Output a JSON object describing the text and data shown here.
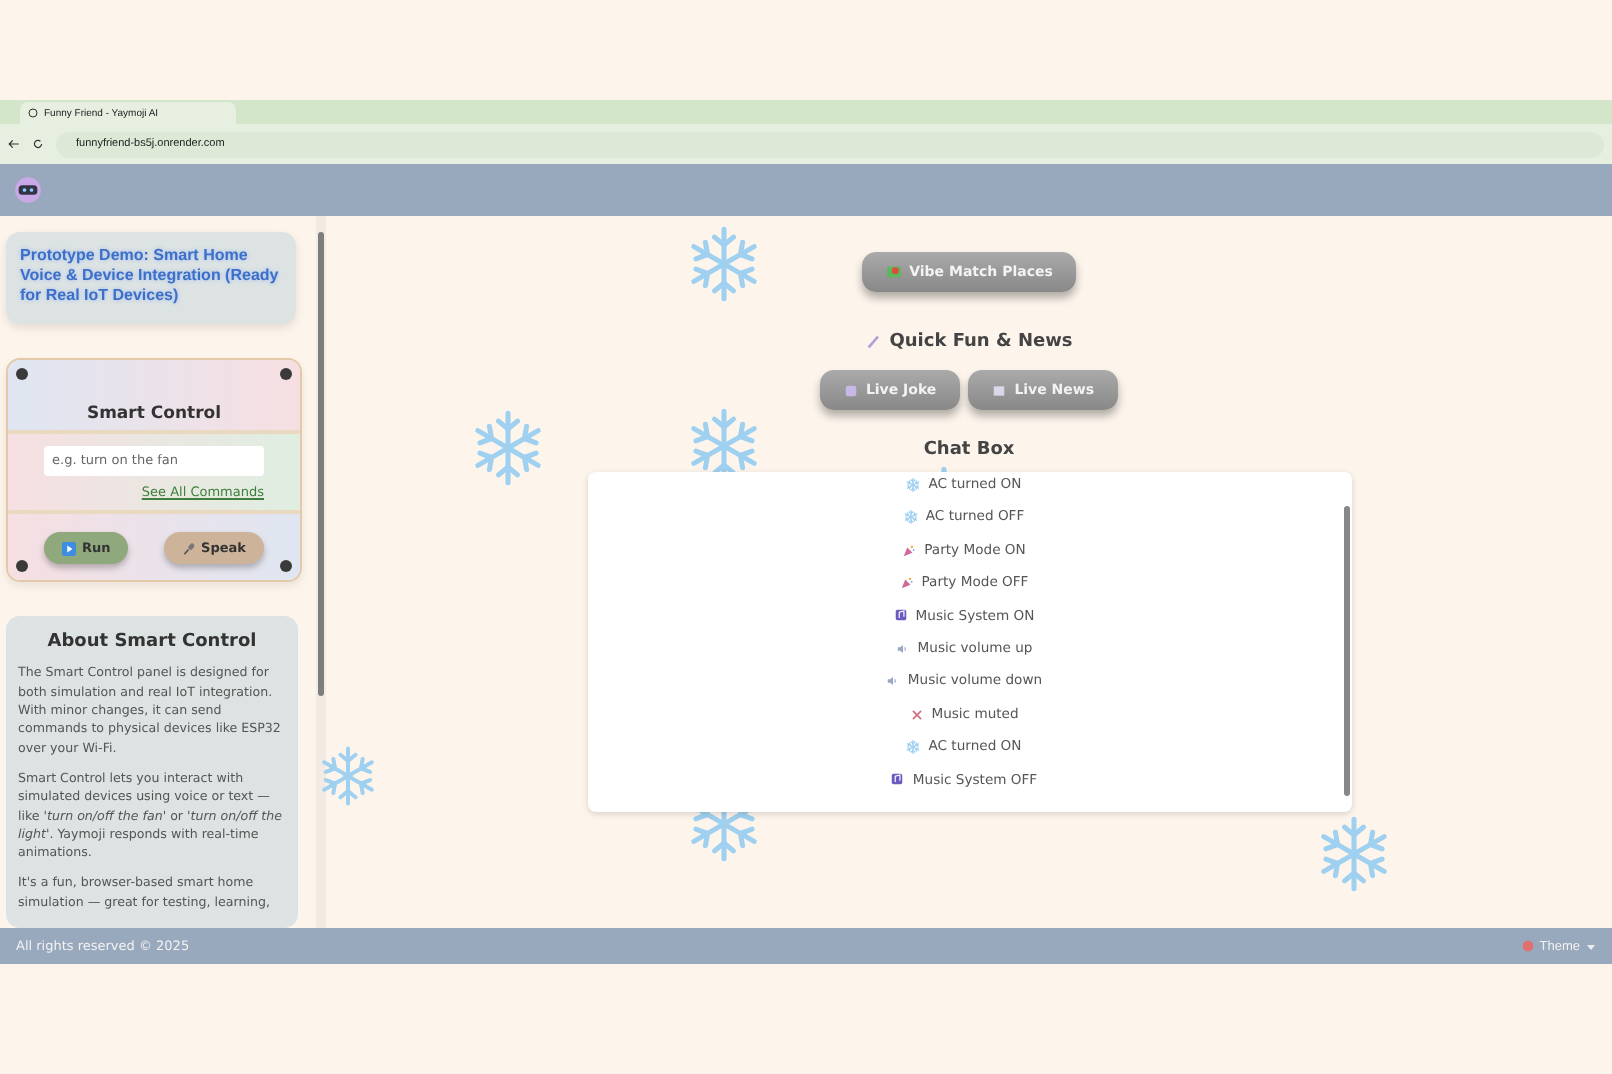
{
  "browser": {
    "tab_title": "Funny Friend - Yaymoji AI",
    "url": "funnyfriend-bs5j.onrender.com"
  },
  "sidebar": {
    "demo_title": "Prototype Demo: Smart Home Voice & Device Integration (Ready for Real IoT Devices)",
    "smart_control": {
      "title": "Smart Control",
      "input_placeholder": "e.g. turn on the fan",
      "commands_link": "See All Commands",
      "buttons": [
        {
          "label": "Run",
          "kind": "run"
        },
        {
          "label": "Speak",
          "kind": "speak"
        }
      ]
    },
    "about": {
      "title": "About Smart Control",
      "paragraphs": [
        "The Smart Control panel is designed for both simulation and real IoT integration. With minor changes, it can send commands to physical devices like ESP32 over your Wi-Fi.",
        "Smart Control lets you interact with simulated devices using voice or text — like *'turn on/off the fan'* or *'turn on/off the light'*. Yaymoji responds with real-time animations.",
        "It's a fun, browser-based smart home simulation — great for testing, learning,"
      ]
    }
  },
  "main": {
    "vibe_button": "Vibe Match Places",
    "fun_heading": "Quick Fun & News",
    "fun_buttons": [
      {
        "label": "Live Joke",
        "kind": "joke"
      },
      {
        "label": "Live News",
        "kind": "news"
      }
    ],
    "chat_title": "Chat Box",
    "chat_messages": [
      {
        "text": "AC turned ON",
        "kind": "snow"
      },
      {
        "text": "AC turned OFF",
        "kind": "snow"
      },
      {
        "text": "Party Mode ON",
        "kind": "party"
      },
      {
        "text": "Party Mode OFF",
        "kind": "party"
      },
      {
        "text": "Music System ON",
        "kind": "music"
      },
      {
        "text": "Music volume up",
        "kind": "speaker"
      },
      {
        "text": "Music volume down",
        "kind": "speaker"
      },
      {
        "text": "Music muted",
        "kind": "mute"
      },
      {
        "text": "AC turned ON",
        "kind": "snow"
      },
      {
        "text": "Music System OFF",
        "kind": "music"
      }
    ]
  },
  "footer": {
    "copyright": "All rights reserved © 2025",
    "theme_menu": "Theme"
  }
}
